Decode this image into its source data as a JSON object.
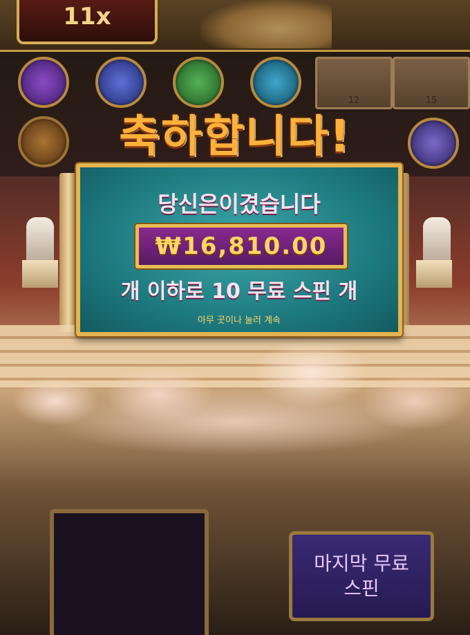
{
  "game": {
    "multiplier": "11x",
    "title": "축하합니다!",
    "win_panel": {
      "heading": "당신은이겼습니다",
      "amount": "₩16,810.00",
      "free_spins_text": "개 이하로 10 무료 스핀 개",
      "continue_hint": "아무 곳이나 눌러 계속"
    },
    "reel_panels": [
      "12",
      "15"
    ],
    "last_free_spin_button": "마지막 무료 스핀"
  },
  "colors": {
    "title": "#ffb13a",
    "panel_teal": "#1d7b80",
    "gold_border": "#e4b451",
    "amount_text": "#ffd663",
    "amount_bg": "#8a2a8e"
  }
}
